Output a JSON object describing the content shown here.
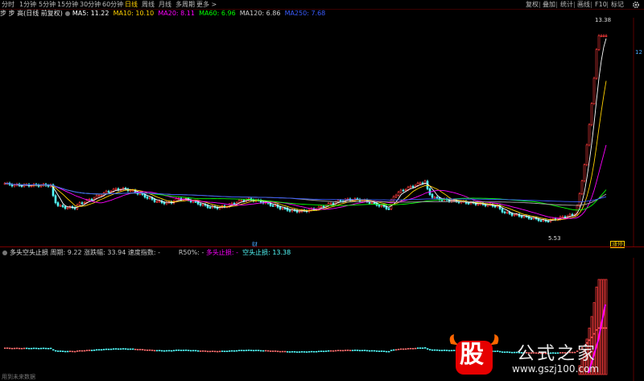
{
  "toolbar": {
    "tabs": [
      "分时",
      "1分钟",
      "5分钟",
      "15分钟",
      "30分钟",
      "60分钟",
      "日线",
      "周线",
      "月线",
      "多周期",
      "更多 >"
    ],
    "active_tab": "日线",
    "right_buttons": [
      "复权",
      "叠加",
      "统计",
      "画线",
      "F10",
      "标记"
    ],
    "gear_icon": "gear-icon"
  },
  "main_legend": {
    "stock_title": "步 步 高(日线 前复权)",
    "ma5": "MA5: 11.22",
    "ma10": "MA10: 10.10",
    "ma20": "MA20: 8.11",
    "ma60": "MA60: 6.96",
    "ma120": "MA120: 6.86",
    "ma250": "MA250: 7.68"
  },
  "labels": {
    "high_price": "13.38",
    "low_price": "5.53",
    "right_edge_value": "12",
    "marker_left": "财",
    "marker_right": "涨停"
  },
  "indicator_legend": {
    "name": "多头空头止损",
    "period": "周期: 9.22",
    "rise_fall": "涨跌幅: 33.94",
    "speed": "速度指数: -",
    "r50": "R50%: -",
    "long_stop": "多头止损: -",
    "short_stop": "空头止损: 13.38"
  },
  "colors": {
    "up_candle": "#ff3b3b",
    "down_candle": "#54ffff",
    "ma5": "#ffffff",
    "ma10": "#ffd000",
    "ma20": "#ff00ff",
    "ma60": "#00ff00",
    "ma120": "#aaaaaa",
    "ma250": "#3a5cff"
  },
  "watermark": {
    "char": "股",
    "title": "公式之家",
    "url": "www.gszj100.com"
  },
  "bottom_note": "用到未来数据"
}
